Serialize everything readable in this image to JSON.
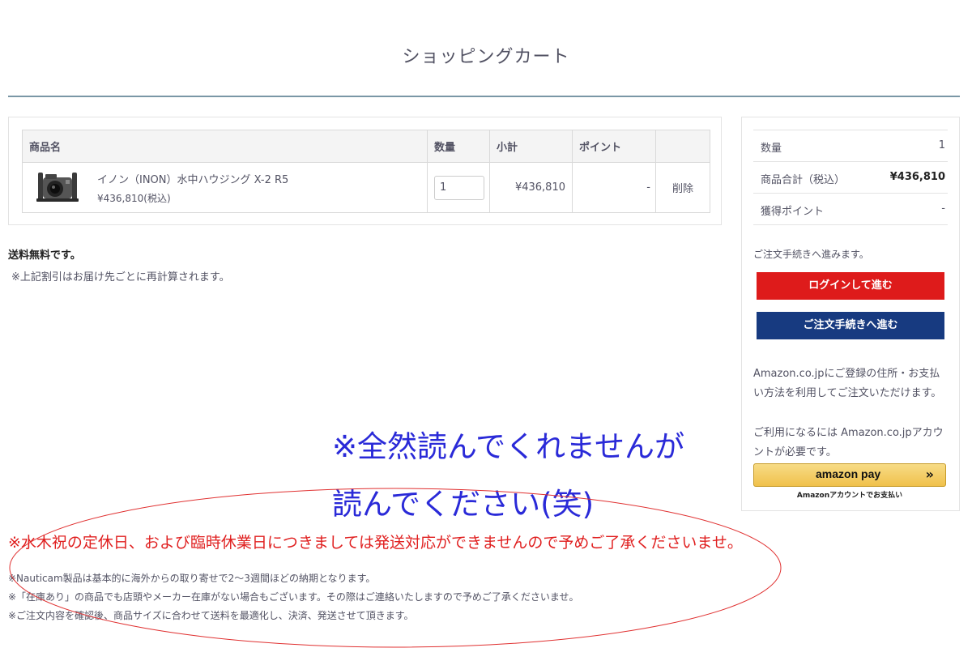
{
  "page": {
    "title": "ショッピングカート"
  },
  "cart": {
    "headers": {
      "product": "商品名",
      "quantity": "数量",
      "subtotal": "小計",
      "points": "ポイント",
      "action": ""
    },
    "items": [
      {
        "name": "イノン（INON）水中ハウジング X-2 R5",
        "price": "¥436,810(税込)",
        "quantity": "1",
        "subtotal": "¥436,810",
        "points": "-",
        "delete_label": "削除"
      }
    ]
  },
  "shipping": {
    "free_label": "送料無料です。",
    "discount_note": "※上記割引はお届け先ごとに再計算されます。"
  },
  "summary": {
    "rows": [
      {
        "label": "数量",
        "value": "1"
      },
      {
        "label": "商品合計（税込）",
        "value": "¥436,810"
      },
      {
        "label": "獲得ポイント",
        "value": "-"
      }
    ],
    "proceed_note": "ご注文手続きへ進みます。",
    "login_button": "ログインして進む",
    "checkout_button": "ご注文手続きへ進む",
    "amazon_text1": "Amazon.co.jpにご登録の住所・お支払い方法を利用してご注文いただけます。",
    "amazon_text2": "ご利用になるには Amazon.co.jpアカウントが必要です。",
    "amazon_pay_label": "amazon pay",
    "amazon_chevron": "»",
    "amazon_sub": "Amazonアカウントでお支払い"
  },
  "annotation": {
    "line1": "※全然読んでくれませんが",
    "line2": "読んでください(笑)"
  },
  "notices": {
    "holiday": "※水木祝の定休日、および臨時休業日につきましては発送対応ができませんので予めご了承くださいませ。",
    "lines": [
      "※Nauticam製品は基本的に海外からの取り寄せで2〜3週間ほどの納期となります。",
      "※「在庫あり」の商品でも店頭やメーカー在庫がない場合もございます。その際はご連絡いたしますので予めご了承くださいませ。",
      "※ご注文内容を確認後、商品サイズに合わせて送料を最適化し、決済、発送させて頂きます。"
    ]
  },
  "colors": {
    "accent_red": "#de1b1b",
    "accent_navy": "#173a80",
    "annotation_blue": "#2a2ad8",
    "notice_red": "#e02020"
  }
}
